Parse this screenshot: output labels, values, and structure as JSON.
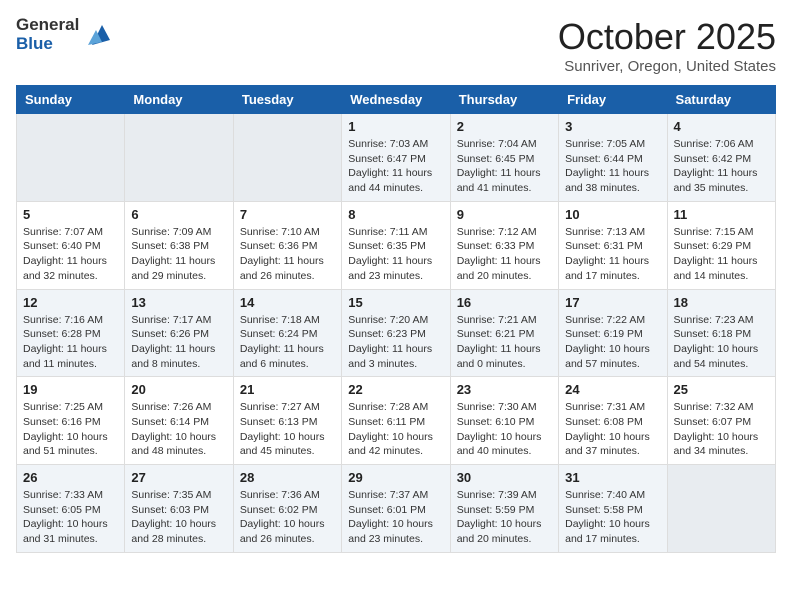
{
  "header": {
    "logo_line1": "General",
    "logo_line2": "Blue",
    "month_title": "October 2025",
    "location": "Sunriver, Oregon, United States"
  },
  "weekdays": [
    "Sunday",
    "Monday",
    "Tuesday",
    "Wednesday",
    "Thursday",
    "Friday",
    "Saturday"
  ],
  "weeks": [
    [
      {
        "day": "",
        "info": ""
      },
      {
        "day": "",
        "info": ""
      },
      {
        "day": "",
        "info": ""
      },
      {
        "day": "1",
        "info": "Sunrise: 7:03 AM\nSunset: 6:47 PM\nDaylight: 11 hours and 44 minutes."
      },
      {
        "day": "2",
        "info": "Sunrise: 7:04 AM\nSunset: 6:45 PM\nDaylight: 11 hours and 41 minutes."
      },
      {
        "day": "3",
        "info": "Sunrise: 7:05 AM\nSunset: 6:44 PM\nDaylight: 11 hours and 38 minutes."
      },
      {
        "day": "4",
        "info": "Sunrise: 7:06 AM\nSunset: 6:42 PM\nDaylight: 11 hours and 35 minutes."
      }
    ],
    [
      {
        "day": "5",
        "info": "Sunrise: 7:07 AM\nSunset: 6:40 PM\nDaylight: 11 hours and 32 minutes."
      },
      {
        "day": "6",
        "info": "Sunrise: 7:09 AM\nSunset: 6:38 PM\nDaylight: 11 hours and 29 minutes."
      },
      {
        "day": "7",
        "info": "Sunrise: 7:10 AM\nSunset: 6:36 PM\nDaylight: 11 hours and 26 minutes."
      },
      {
        "day": "8",
        "info": "Sunrise: 7:11 AM\nSunset: 6:35 PM\nDaylight: 11 hours and 23 minutes."
      },
      {
        "day": "9",
        "info": "Sunrise: 7:12 AM\nSunset: 6:33 PM\nDaylight: 11 hours and 20 minutes."
      },
      {
        "day": "10",
        "info": "Sunrise: 7:13 AM\nSunset: 6:31 PM\nDaylight: 11 hours and 17 minutes."
      },
      {
        "day": "11",
        "info": "Sunrise: 7:15 AM\nSunset: 6:29 PM\nDaylight: 11 hours and 14 minutes."
      }
    ],
    [
      {
        "day": "12",
        "info": "Sunrise: 7:16 AM\nSunset: 6:28 PM\nDaylight: 11 hours and 11 minutes."
      },
      {
        "day": "13",
        "info": "Sunrise: 7:17 AM\nSunset: 6:26 PM\nDaylight: 11 hours and 8 minutes."
      },
      {
        "day": "14",
        "info": "Sunrise: 7:18 AM\nSunset: 6:24 PM\nDaylight: 11 hours and 6 minutes."
      },
      {
        "day": "15",
        "info": "Sunrise: 7:20 AM\nSunset: 6:23 PM\nDaylight: 11 hours and 3 minutes."
      },
      {
        "day": "16",
        "info": "Sunrise: 7:21 AM\nSunset: 6:21 PM\nDaylight: 11 hours and 0 minutes."
      },
      {
        "day": "17",
        "info": "Sunrise: 7:22 AM\nSunset: 6:19 PM\nDaylight: 10 hours and 57 minutes."
      },
      {
        "day": "18",
        "info": "Sunrise: 7:23 AM\nSunset: 6:18 PM\nDaylight: 10 hours and 54 minutes."
      }
    ],
    [
      {
        "day": "19",
        "info": "Sunrise: 7:25 AM\nSunset: 6:16 PM\nDaylight: 10 hours and 51 minutes."
      },
      {
        "day": "20",
        "info": "Sunrise: 7:26 AM\nSunset: 6:14 PM\nDaylight: 10 hours and 48 minutes."
      },
      {
        "day": "21",
        "info": "Sunrise: 7:27 AM\nSunset: 6:13 PM\nDaylight: 10 hours and 45 minutes."
      },
      {
        "day": "22",
        "info": "Sunrise: 7:28 AM\nSunset: 6:11 PM\nDaylight: 10 hours and 42 minutes."
      },
      {
        "day": "23",
        "info": "Sunrise: 7:30 AM\nSunset: 6:10 PM\nDaylight: 10 hours and 40 minutes."
      },
      {
        "day": "24",
        "info": "Sunrise: 7:31 AM\nSunset: 6:08 PM\nDaylight: 10 hours and 37 minutes."
      },
      {
        "day": "25",
        "info": "Sunrise: 7:32 AM\nSunset: 6:07 PM\nDaylight: 10 hours and 34 minutes."
      }
    ],
    [
      {
        "day": "26",
        "info": "Sunrise: 7:33 AM\nSunset: 6:05 PM\nDaylight: 10 hours and 31 minutes."
      },
      {
        "day": "27",
        "info": "Sunrise: 7:35 AM\nSunset: 6:03 PM\nDaylight: 10 hours and 28 minutes."
      },
      {
        "day": "28",
        "info": "Sunrise: 7:36 AM\nSunset: 6:02 PM\nDaylight: 10 hours and 26 minutes."
      },
      {
        "day": "29",
        "info": "Sunrise: 7:37 AM\nSunset: 6:01 PM\nDaylight: 10 hours and 23 minutes."
      },
      {
        "day": "30",
        "info": "Sunrise: 7:39 AM\nSunset: 5:59 PM\nDaylight: 10 hours and 20 minutes."
      },
      {
        "day": "31",
        "info": "Sunrise: 7:40 AM\nSunset: 5:58 PM\nDaylight: 10 hours and 17 minutes."
      },
      {
        "day": "",
        "info": ""
      }
    ]
  ]
}
